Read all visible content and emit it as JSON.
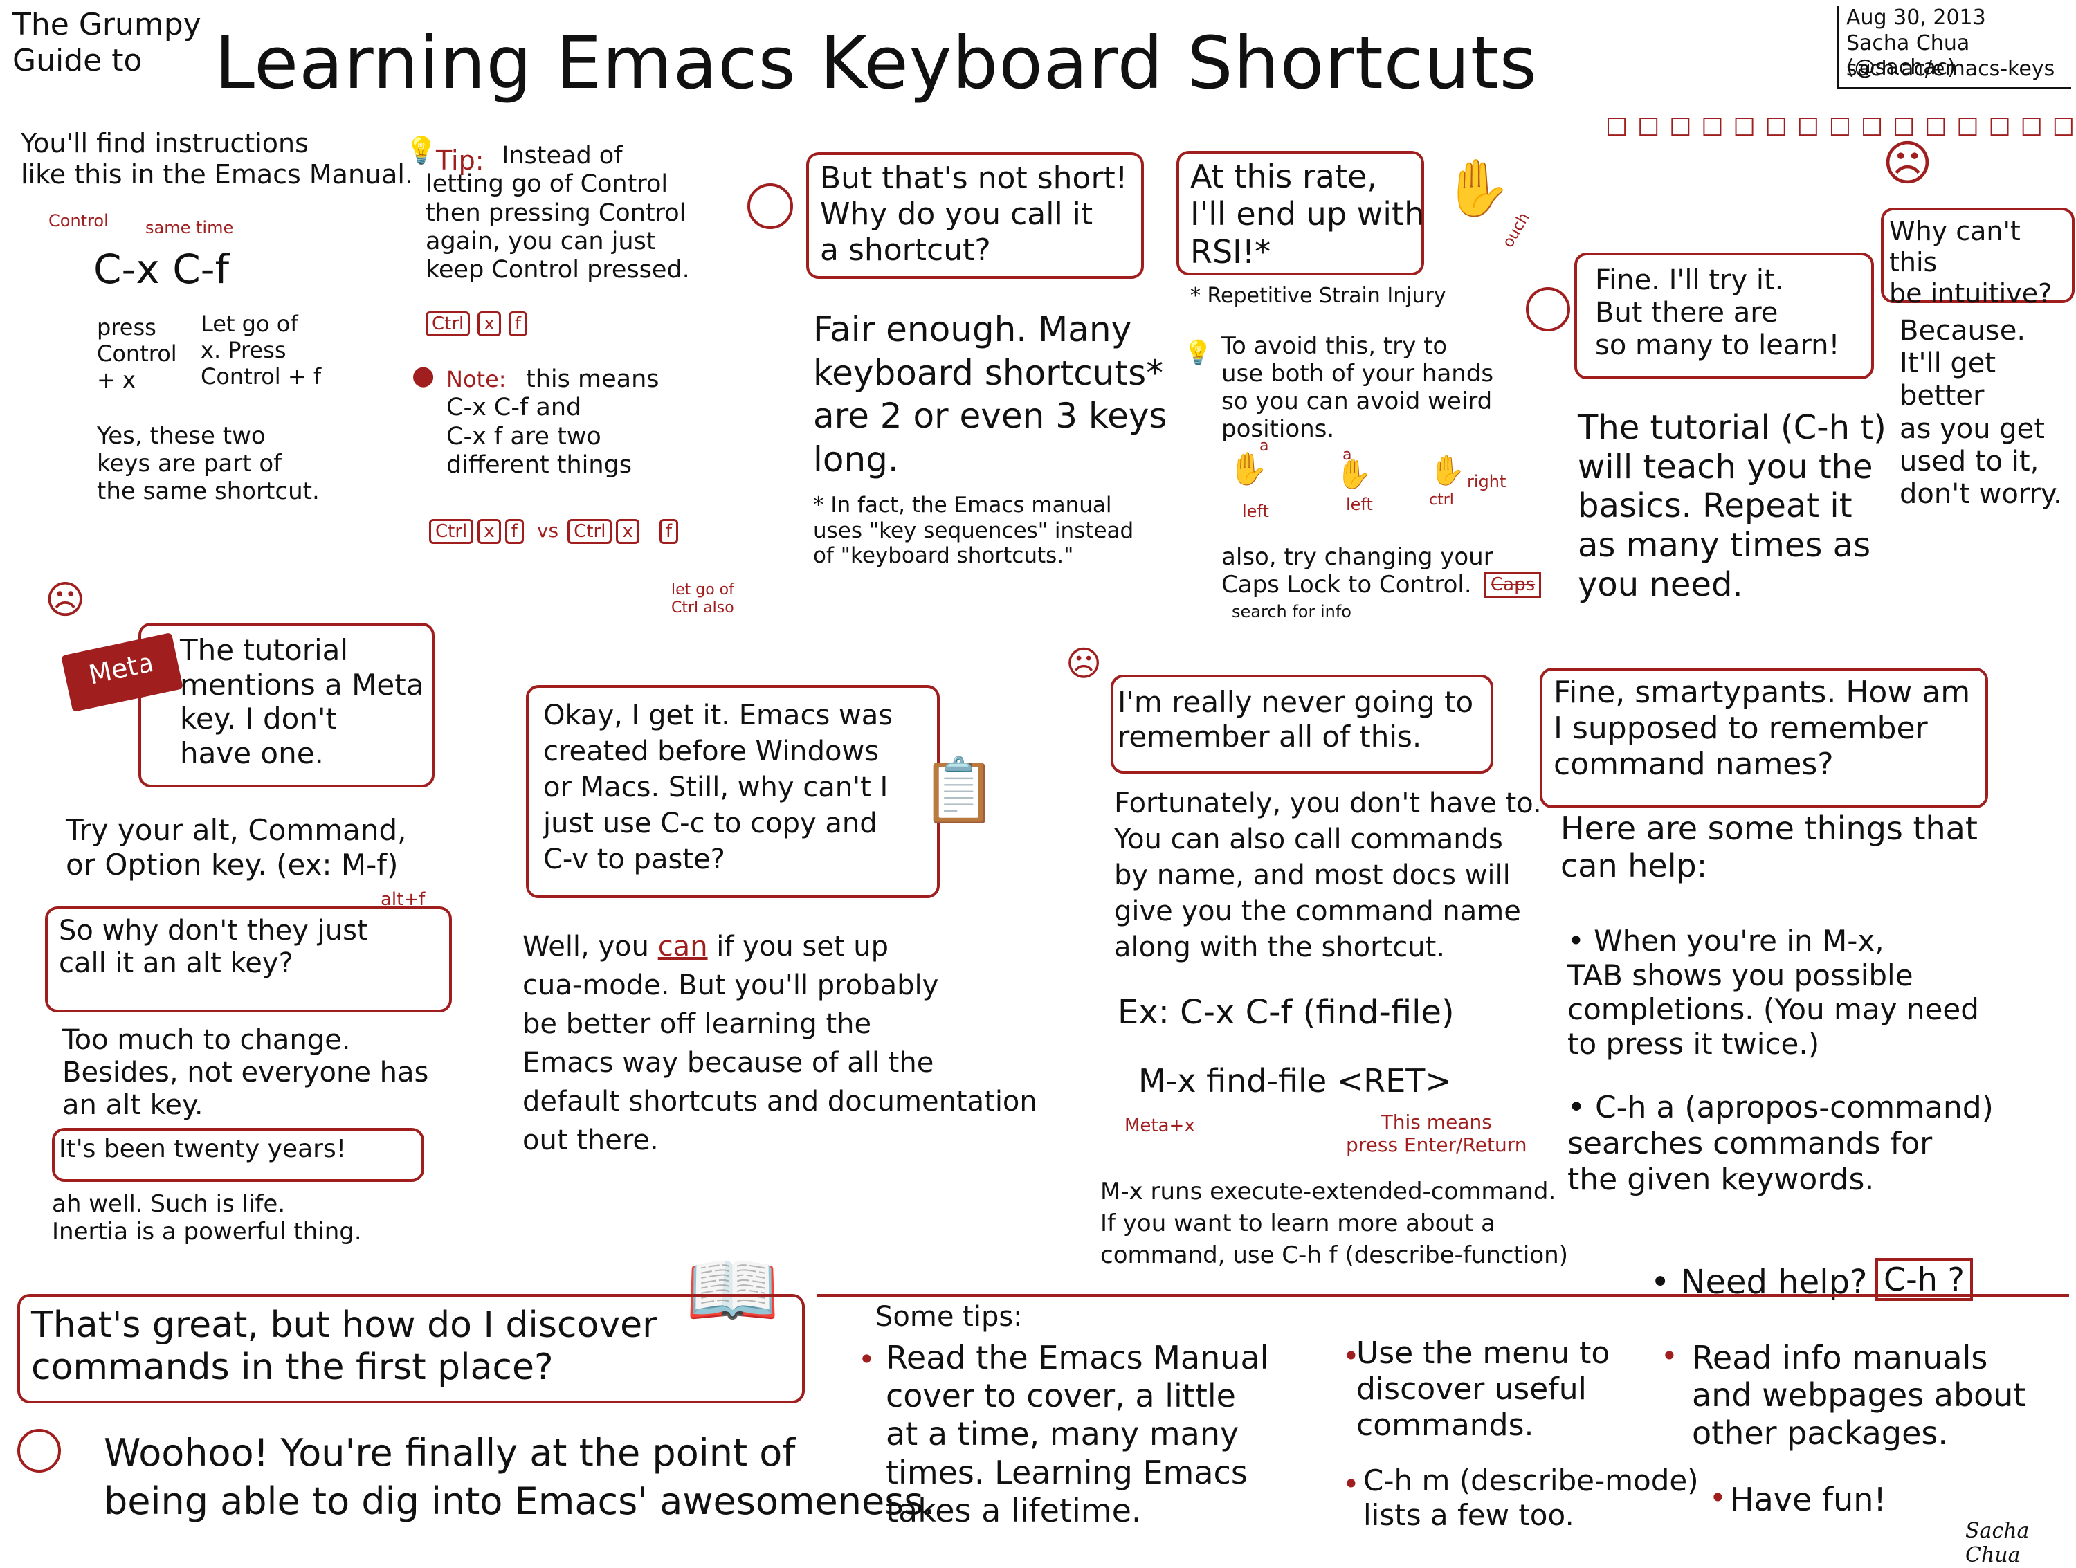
{
  "header": {
    "subtitle": "The Grumpy\nGuide to",
    "title": "Learning Emacs Keyboard Shortcuts",
    "date": "Aug 30, 2013",
    "author": "Sacha Chua (@sachac)",
    "url": "sach.ac/emacs-keys"
  },
  "manual": {
    "intro": "You'll find instructions\nlike this in the Emacs Manual.",
    "label_control": "Control",
    "label_same_time": "same time",
    "keys": "C-x  C-f",
    "press_control_x": "press\nControl\n+ x",
    "let_go": "Let go of\nx. Press\nControl + f",
    "same_shortcut": "Yes, these two\nkeys are part of\nthe same shortcut."
  },
  "tip": {
    "label": "Tip:",
    "text": "Instead of\nletting go of Control\nthen pressing Control\nagain, you can just\nkeep Control pressed.",
    "keys": [
      "Ctrl",
      "x",
      "f"
    ],
    "note_label": "Note:",
    "note_text": "this means\nC-x C-f and\nC-x f are two\ndifferent things",
    "vs": "vs",
    "keys_left": [
      "Ctrl",
      "x",
      "f"
    ],
    "keys_right": [
      "Ctrl",
      "x",
      "f"
    ],
    "let_go_also": "let go of\nCtrl also"
  },
  "shortcut": {
    "bubble": "But that's not short!\nWhy do you call it\na shortcut?",
    "answer": "Fair enough. Many\nkeyboard shortcuts*\nare 2 or even 3 keys\nlong.",
    "footnote": "* In fact, the Emacs manual\nuses \"key sequences\" instead\nof \"keyboard shortcuts.\""
  },
  "rsi": {
    "bubble": "At this rate,\nI'll end up with\nRSI!*",
    "ouch": "ouch",
    "footnote": "* Repetitive Strain Injury",
    "tip": "To avoid this, try to\nuse both of your hands\nso you can avoid weird\npositions.",
    "hand_a1": "a",
    "hand_left1": "left",
    "hand_a2": "a",
    "hand_left2": "left",
    "hand_ctrl": "ctrl",
    "hand_right": "right",
    "caps": "also, try changing your\nCaps Lock to Control.",
    "caps_key": "Caps",
    "search_info": "search for info"
  },
  "learn": {
    "bubble": "Fine. I'll try it.\nBut there are\nso many to learn!",
    "answer": "The tutorial (C-h t)\nwill teach you the\nbasics. Repeat it\nas many times as\nyou need."
  },
  "intuitive": {
    "bubble": "Why can't this\nbe intuitive?",
    "answer": "Because.\nIt'll get better\nas you get\nused to it,\ndon't worry."
  },
  "meta": {
    "key": "Meta",
    "bubble": "The tutorial\nmentions a Meta\nkey. I don't\nhave one.",
    "answer": "Try your alt, Command,\nor Option key. (ex: M-f)",
    "alt_f": "alt+f",
    "why_bubble": "So why don't they just\ncall it an alt key?",
    "too_much": "Too much to change.\nBesides, not everyone has\nan alt key.",
    "twenty": "It's been twenty years!",
    "inertia": "ah well. Such is life.\nInertia is a powerful thing."
  },
  "cua": {
    "bubble": "Okay, I get it. Emacs was\ncreated before Windows\nor Macs. Still, why can't I\njust use C-c to copy and\nC-v to paste?",
    "answer_pre": "Well, you ",
    "answer_can": "can",
    "answer_post": " if you set up\ncua-mode. But you'll probably\nbe better off learning the\nEmacs way because of all the\ndefault shortcuts and documentation\nout there."
  },
  "remember": {
    "bubble": "I'm really never going to\nremember all of this.",
    "answer": "Fortunately, you don't have to.\nYou can also call commands\nby name, and most docs will\ngive you the command name\nalong with the shortcut.",
    "ex": "Ex:  C-x C-f (find-file)",
    "mx_line": "M-x  find-file <RET>",
    "meta_x": "Meta+x",
    "enter_note": "This means\npress Enter/Return",
    "mx_runs": "M-x runs execute-extended-command.\nIf you want to learn more about a\ncommand, use C-h f (describe-function)"
  },
  "names": {
    "bubble": "Fine, smartypants. How am\nI supposed to remember\ncommand names?",
    "intro": "Here are some things that\ncan help:",
    "bullets": [
      "When you're in M-x,\nTAB shows you possible\ncompletions. (You may need\nto press it twice.)",
      "C-h a (apropos-command)\nsearches commands for\nthe given keywords."
    ],
    "need_help": "Need help?",
    "need_help_key": "C-h ?"
  },
  "discover": {
    "bubble": "That's great, but how do I discover\ncommands in the first place?",
    "answer": "Woohoo! You're finally at the point of\nbeing able to dig into Emacs' awesomeness.",
    "tips_title": "Some tips:",
    "tip1": "Read the Emacs Manual\ncover to cover, a little\nat a time, many many\ntimes. Learning Emacs\ntakes a lifetime.",
    "tip2": "Use the menu to\ndiscover useful\ncommands.",
    "tip3": "C-h m (describe-mode)\nlists a few too.",
    "tip4": "Read info manuals\nand webpages about\nother packages.",
    "tip5": "Have fun!",
    "signature": "Sacha Chua"
  },
  "colors": {
    "accent": "#a01e1e",
    "ink": "#111111"
  },
  "icons": [
    "lightbulb-icon",
    "bomb-icon",
    "frowning-face-icon",
    "hand-icon",
    "keyboard-key-icon",
    "clipboard-icon",
    "book-icon",
    "smiley-icon"
  ]
}
